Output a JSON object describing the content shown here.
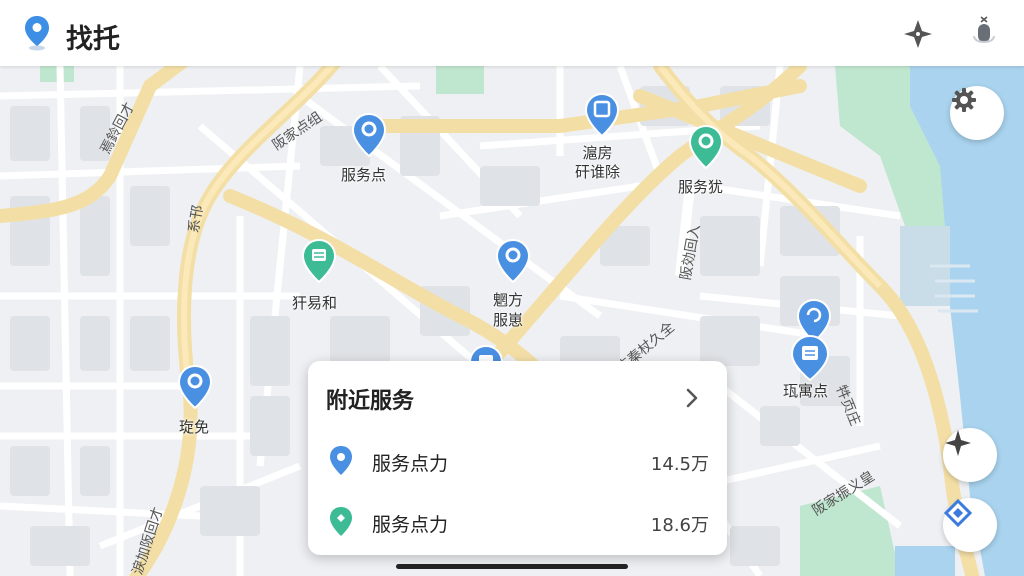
{
  "app": {
    "title": "找托"
  },
  "header_icons": {
    "brand": "location-pin-icon",
    "navigate": "navigation-arrow-icon",
    "voice": "microphone-icon"
  },
  "map": {
    "pois": [
      {
        "label": "服务点",
        "icon": "location-pin-icon",
        "color": "#4a90e2"
      },
      {
        "label": "滬房\n矸谁除",
        "icon": "edit-pin-icon",
        "color": "#4a90e2"
      },
      {
        "label": "服务犹",
        "icon": "location-pin-icon",
        "color": "#3dbb95"
      },
      {
        "label": "犴易和",
        "icon": "store-pin-icon",
        "color": "#3dbb95"
      },
      {
        "label": "魍方\n服崽",
        "icon": "location-pin-icon",
        "color": "#4a90e2"
      },
      {
        "label": "琁免",
        "icon": "location-pin-icon",
        "color": "#4a90e2"
      },
      {
        "label": "珁寓点",
        "icon": "store-pin-icon",
        "color": "#4a90e2"
      }
    ],
    "streets": [
      "焉鈴回才",
      "阪家点组",
      "系邗",
      "阪効回入",
      "陈秦杖久全",
      "牪页庄",
      "阪家振义皇",
      "淚加阪回才"
    ]
  },
  "nearby_card": {
    "title": "附近服务",
    "items": [
      {
        "name": "服务点力",
        "distance": "14.5万",
        "color": "#4a90e2"
      },
      {
        "name": "服务点力",
        "distance": "18.6万",
        "color": "#3dbb95"
      }
    ]
  },
  "fabs": {
    "settings": "gear-icon",
    "compass": "compass-icon",
    "locate": "locate-diamond-icon"
  },
  "colors": {
    "primary_blue": "#4a90e2",
    "green": "#3dbb95",
    "road": "#f3dfa6",
    "water": "#a9d3ee",
    "park": "#bfe6cf"
  }
}
